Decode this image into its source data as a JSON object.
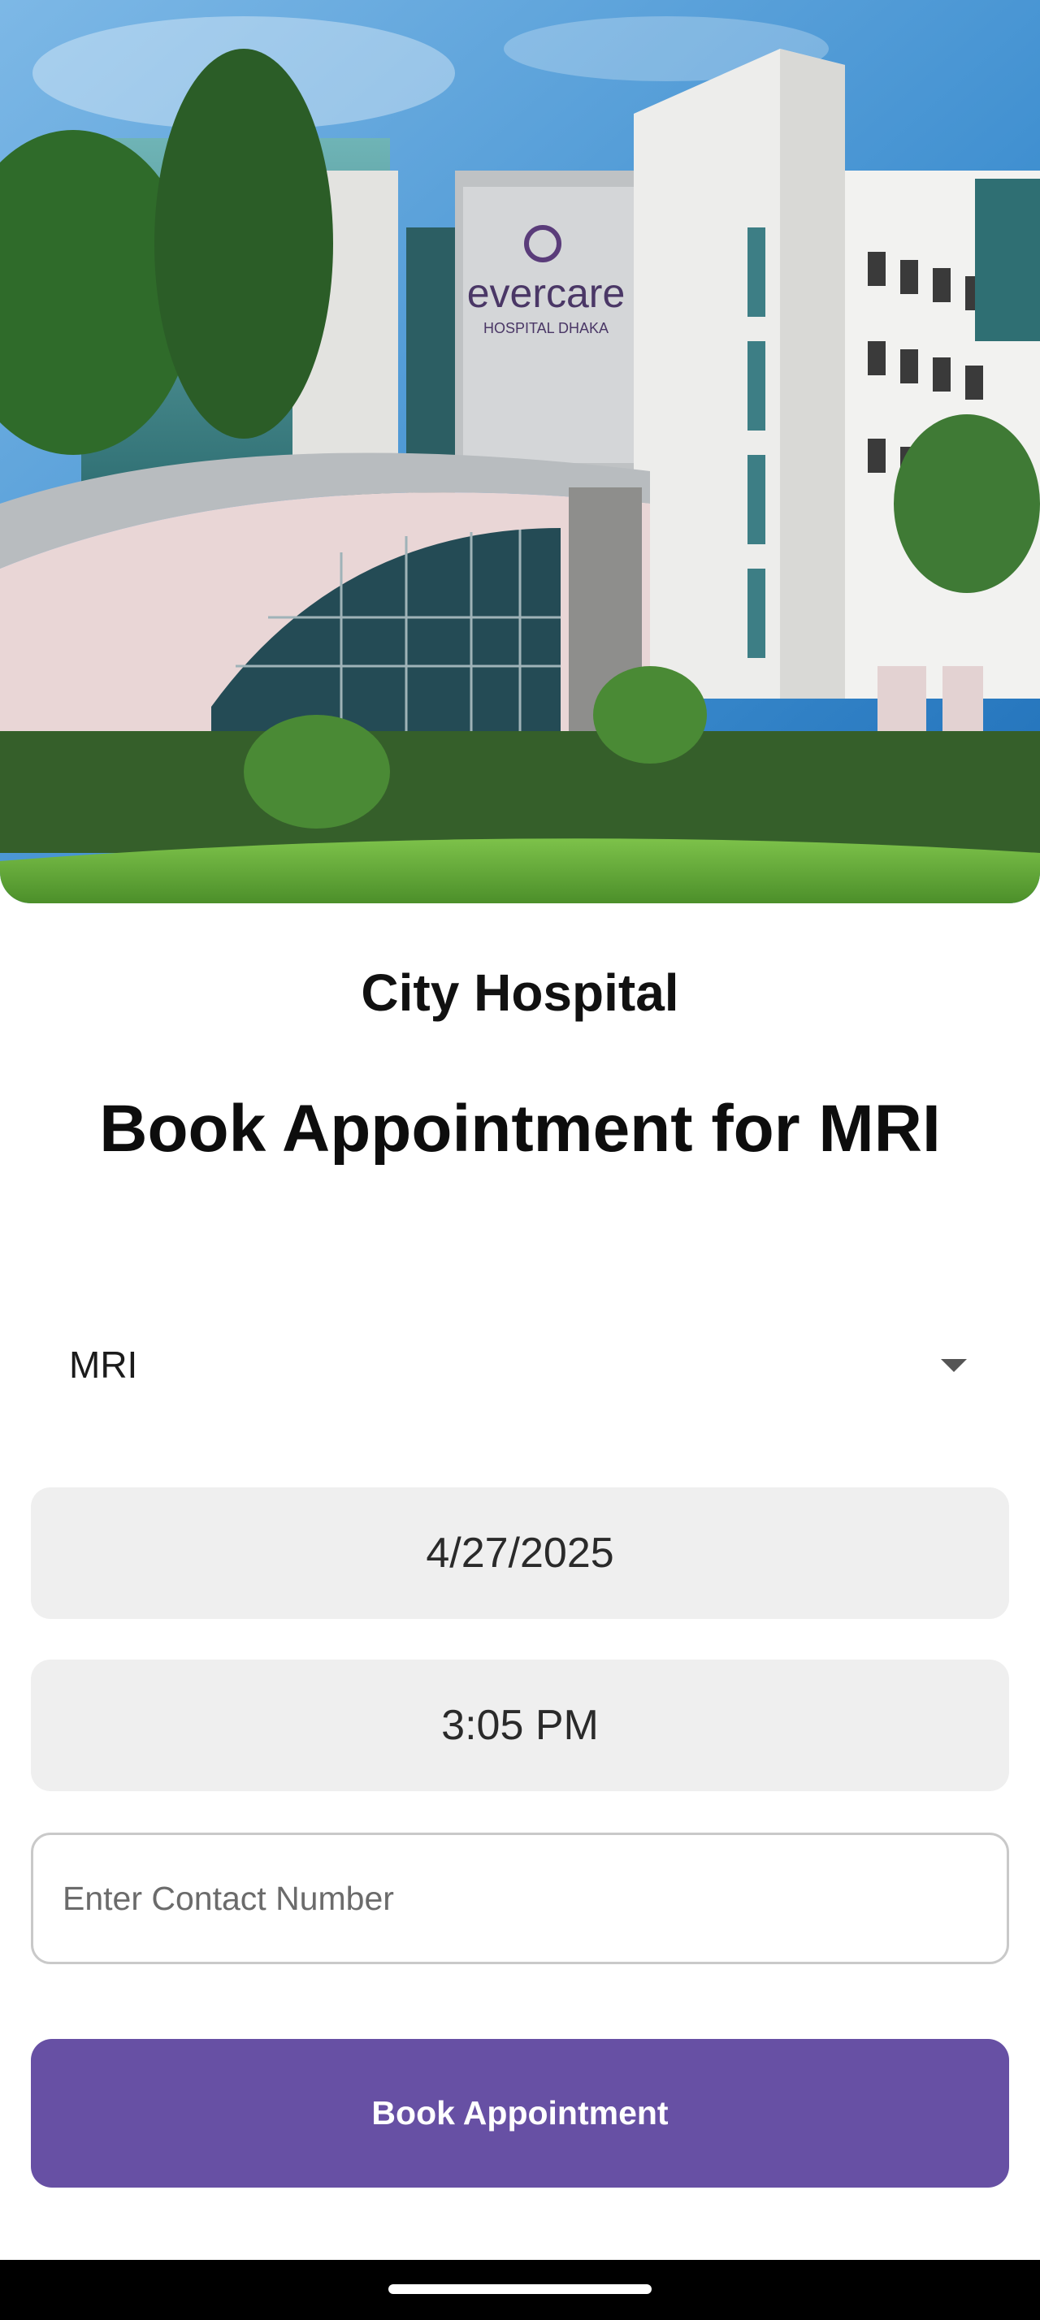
{
  "hero": {
    "brand_text": "evercare",
    "brand_subtext": "HOSPITAL DHAKA"
  },
  "header": {
    "hospital_name": "City Hospital",
    "title": "Book Appointment for MRI"
  },
  "form": {
    "test_type": {
      "selected": "MRI"
    },
    "date": {
      "value": "4/27/2025"
    },
    "time": {
      "value": "3:05 PM"
    },
    "contact": {
      "placeholder": "Enter Contact Number",
      "value": ""
    },
    "submit_label": "Book Appointment"
  },
  "colors": {
    "primary": "#6750a4",
    "field_bg": "#efefef",
    "field_border": "#c9c9c9"
  }
}
